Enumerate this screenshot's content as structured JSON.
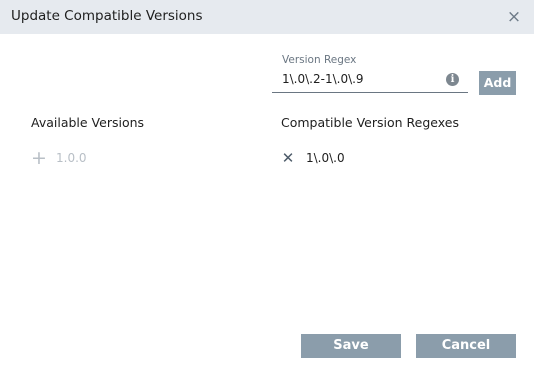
{
  "dialog": {
    "title": "Update Compatible Versions",
    "close_glyph": "×"
  },
  "regex_field": {
    "label": "Version Regex",
    "value": "1\\.0\\.2-1\\.0\\.9",
    "info_glyph": "i",
    "info_icon": "info-icon",
    "add_label": "Add"
  },
  "available": {
    "header": "Available Versions",
    "items": [
      {
        "icon": "plus-icon",
        "glyph": "+",
        "label": "1.0.0"
      }
    ]
  },
  "compatible": {
    "header": "Compatible Version Regexes",
    "items": [
      {
        "icon": "remove-icon",
        "glyph": "✕",
        "label": "1\\.0\\.0"
      }
    ]
  },
  "actions": {
    "save_label": "Save",
    "cancel_label": "Cancel"
  },
  "colors": {
    "titlebar_bg": "#e6eaef",
    "button_bg": "#8b9dab",
    "disabled_text": "#b8bfc6",
    "icon_gray": "#6d7a87"
  }
}
